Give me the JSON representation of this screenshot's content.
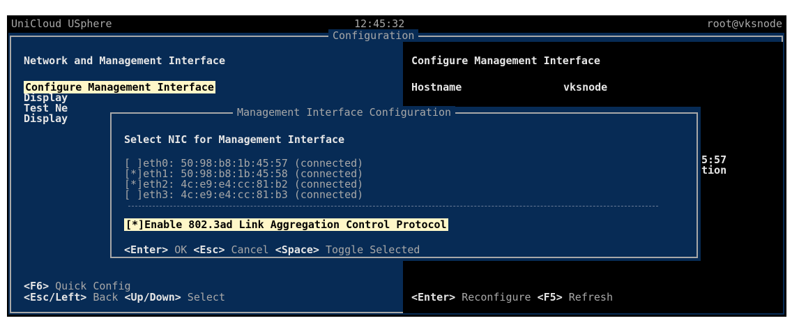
{
  "topbar": {
    "product": "UniCloud USphere",
    "time": "12:45:32",
    "user": "root@vksnode"
  },
  "config_frame": {
    "title": "Configuration"
  },
  "left": {
    "heading": "Network and Management Interface",
    "items": [
      {
        "label": "Configure Management Interface",
        "selected": true
      },
      {
        "label": "Display",
        "selected": false
      },
      {
        "label": "Test Ne",
        "selected": false
      },
      {
        "label": "Display",
        "selected": false
      }
    ],
    "footer": [
      {
        "key": "<F6>",
        "text": " Quick Config"
      },
      {
        "key": "<Esc/Left>",
        "text": " Back ",
        "key2": "<Up/Down>",
        "text2": " Select"
      }
    ]
  },
  "right": {
    "heading": "Configure Management Interface",
    "hostname_label": "Hostname",
    "hostname_value": "vksnode",
    "partial1": "5:57",
    "partial2": "tion",
    "footer": {
      "key1": "<Enter>",
      "text1": " Reconfigure ",
      "key2": "<F5>",
      "text2": " Refresh"
    }
  },
  "dialog": {
    "title": "Management Interface Configuration",
    "heading": "Select NIC for Management Interface",
    "nics": [
      {
        "mark": "[ ]",
        "label": "eth0: 50:98:b8:1b:45:57 (connected)"
      },
      {
        "mark": "[*]",
        "label": "eth1: 50:98:b8:1b:45:58 (connected)"
      },
      {
        "mark": "[*]",
        "label": "eth2: 4c:e9:e4:cc:81:b2 (connected)"
      },
      {
        "mark": "[ ]",
        "label": "eth3: 4c:e9:e4:cc:81:b3 (connected)"
      }
    ],
    "lacp": "[*]Enable 802.3ad Link Aggregation Control Protocol",
    "footer": {
      "k1": "<Enter>",
      "t1": " OK ",
      "k2": "<Esc>",
      "t2": " Cancel ",
      "k3": "<Space>",
      "t3": " Toggle Selected"
    }
  }
}
